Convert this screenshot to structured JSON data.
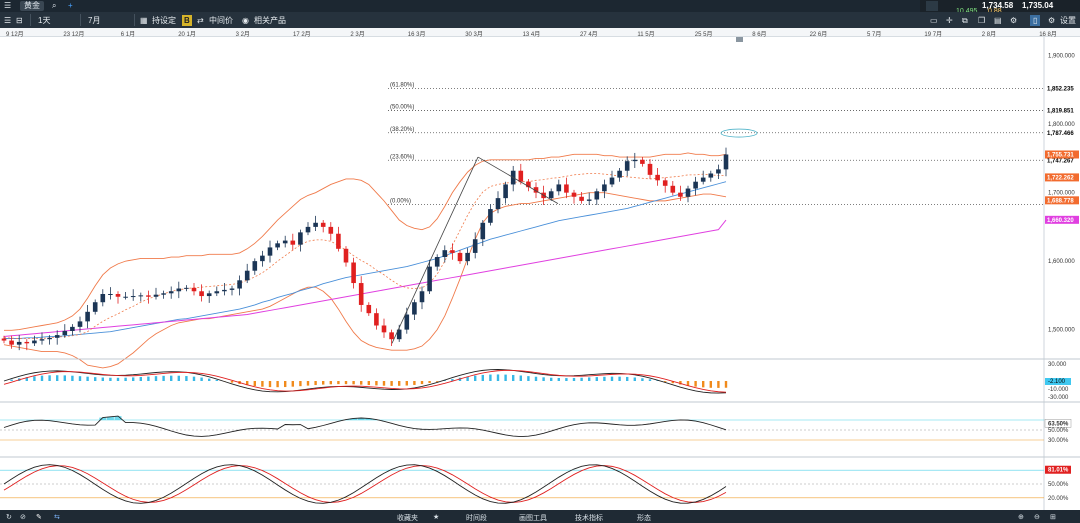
{
  "app": {
    "menu_icon": "hamburger-menu-icon",
    "instrument_tab": "黄金",
    "search_icon": "search-icon",
    "add_icon": "plus-icon",
    "quote_top": "1,734.58",
    "quote_top2": "1,735.04",
    "change_small": "10.495",
    "change_small2": "0.88"
  },
  "toolbar": {
    "interval": "1天",
    "range": "7月",
    "settings_label": "持设定",
    "badge": "B",
    "middle_price_label": "中间价",
    "related_label": "相关产品",
    "settings_right": "设置"
  },
  "date_axis": {
    "labels": [
      "9 12月",
      "23 12月",
      "6 1月",
      "20 1月",
      "3 2月",
      "17 2月",
      "2 3月",
      "16 3月",
      "30 3月",
      "13 4月",
      "27 4月",
      "11 5月",
      "25 5月",
      "8 6月",
      "22 6月",
      "5 7月",
      "19 7月",
      "2 8月",
      "16 8月"
    ]
  },
  "price_labels": {
    "p1900": "1,900.000",
    "p1852": "1,852.235",
    "p1819": "1,819.851",
    "p1800": "1,800.000",
    "p1787": "1,787.466",
    "p1755": "1,755.731",
    "p1747": "1,747.267",
    "p1722": "1,722.262",
    "p1700": "1,700.000",
    "p1688": "1,688.778",
    "p1660": "1,660.320",
    "p1600": "1,600.000",
    "p1500": "1,500.000"
  },
  "fib_labels": [
    "(61.80%)",
    "(50.00%)",
    "(38.20%)",
    "(23.60%)",
    "(0.00%)"
  ],
  "macd_labels": {
    "top": "30.000",
    "value": "-2.100",
    "mid": "-10.000",
    "bottom": "-30.000"
  },
  "rsi_labels": {
    "value": "63.50%",
    "l1": "50.00%",
    "l2": "30.00%"
  },
  "stoch_labels": {
    "value": "81.01%",
    "l1": "50.00%",
    "l2": "20.00%"
  },
  "bottom_bar": {
    "favorites": "收藏夹",
    "star": "★",
    "timeframe": "时间段",
    "drawing_tools": "画图工具",
    "indicators": "技术指标",
    "patterns": "形态"
  },
  "colors": {
    "bull": "#1b3555",
    "bear": "#e02020",
    "bollinger": "#f07a4a",
    "sma_blue": "#4a90d9",
    "sma_magenta": "#e040e0",
    "rsi_fill": "#4fd1e8"
  },
  "chart_data": {
    "type": "candlestick",
    "title": "黄金",
    "interval": "1天",
    "ylim": [
      1460,
      1920
    ],
    "x_range": [
      "9 12月",
      "16 8月"
    ],
    "fibonacci": [
      {
        "label": "(61.80%)",
        "price": 1852.235
      },
      {
        "label": "(50.00%)",
        "price": 1819.851
      },
      {
        "label": "(38.20%)",
        "price": 1787.466
      },
      {
        "label": "(23.60%)",
        "price": 1747.267
      },
      {
        "label": "(0.00%)",
        "price": 1682.5
      }
    ],
    "last_price": 1755.731,
    "series": [
      {
        "name": "Bollinger upper",
        "values": [
          1499,
          1499,
          1500,
          1502,
          1504,
          1506,
          1508,
          1510,
          1514,
          1520,
          1530,
          1546,
          1564,
          1580,
          1590,
          1596,
          1600,
          1602,
          1604,
          1604,
          1604,
          1604,
          1606,
          1606,
          1608,
          1608,
          1608,
          1610,
          1610,
          1610,
          1610,
          1612,
          1618,
          1626,
          1636,
          1648,
          1660,
          1670,
          1680,
          1690,
          1696,
          1700,
          1706,
          1712,
          1716,
          1720,
          1720,
          1718,
          1712,
          1700,
          1688,
          1674,
          1660,
          1652,
          1648,
          1646,
          1650,
          1662,
          1680,
          1700,
          1716,
          1730,
          1740,
          1746,
          1748,
          1748,
          1748,
          1748,
          1748,
          1748,
          1750,
          1750,
          1752,
          1752,
          1754,
          1756,
          1756,
          1756,
          1756,
          1754,
          1754,
          1752,
          1752,
          1752,
          1752,
          1752,
          1754,
          1756,
          1756,
          1756,
          1758,
          1756,
          1756,
          1754,
          1754,
          1756
        ]
      },
      {
        "name": "Bollinger lower",
        "values": [
          1478,
          1476,
          1474,
          1472,
          1470,
          1468,
          1468,
          1468,
          1466,
          1462,
          1456,
          1448,
          1446,
          1444,
          1446,
          1450,
          1458,
          1466,
          1476,
          1486,
          1494,
          1500,
          1506,
          1510,
          1512,
          1514,
          1516,
          1516,
          1518,
          1520,
          1522,
          1524,
          1526,
          1528,
          1530,
          1534,
          1540,
          1546,
          1552,
          1558,
          1562,
          1562,
          1556,
          1546,
          1530,
          1512,
          1496,
          1484,
          1478,
          1474,
          1472,
          1470,
          1470,
          1470,
          1472,
          1476,
          1486,
          1500,
          1520,
          1546,
          1574,
          1604,
          1632,
          1656,
          1670,
          1676,
          1680,
          1682,
          1684,
          1684,
          1686,
          1688,
          1690,
          1692,
          1694,
          1696,
          1698,
          1700,
          1700,
          1700,
          1698,
          1696,
          1694,
          1692,
          1690,
          1688,
          1688,
          1688,
          1690,
          1692,
          1694,
          1696,
          1698,
          1698,
          1696,
          1694
        ]
      },
      {
        "name": "SMA blue",
        "values": [
          1487,
          1487,
          1487,
          1488,
          1488,
          1489,
          1490,
          1490,
          1491,
          1492,
          1493,
          1494,
          1495,
          1496,
          1497,
          1499,
          1501,
          1503,
          1505,
          1507,
          1509,
          1511,
          1513,
          1515,
          1516,
          1518,
          1520,
          1522,
          1524,
          1526,
          1528,
          1530,
          1533,
          1536,
          1540,
          1543,
          1547,
          1550,
          1553,
          1557,
          1560,
          1563,
          1567,
          1570,
          1573,
          1576,
          1578,
          1580,
          1582,
          1584,
          1586,
          1588,
          1590,
          1592,
          1595,
          1598,
          1601,
          1604,
          1608,
          1612,
          1616,
          1620,
          1624,
          1628,
          1632,
          1635,
          1638,
          1641,
          1644,
          1647,
          1650,
          1653,
          1656,
          1659,
          1661,
          1663,
          1665,
          1667,
          1669,
          1671,
          1673,
          1675,
          1677,
          1680,
          1683,
          1686,
          1689,
          1692,
          1695,
          1698,
          1701,
          1704,
          1707,
          1710,
          1713,
          1716
        ]
      },
      {
        "name": "SMA magenta",
        "values": [
          1490,
          1491,
          1492,
          1493,
          1494,
          1495,
          1496,
          1497,
          1498,
          1499,
          1500,
          1501,
          1502,
          1503,
          1504,
          1505,
          1506,
          1507,
          1508,
          1509,
          1510,
          1511,
          1512,
          1513,
          1514,
          1515,
          1516,
          1517,
          1518,
          1519,
          1520,
          1521,
          1522,
          1524,
          1526,
          1528,
          1530,
          1532,
          1534,
          1536,
          1538,
          1540,
          1542,
          1544,
          1546,
          1548,
          1550,
          1552,
          1554,
          1556,
          1558,
          1560,
          1562,
          1564,
          1566,
          1568,
          1570,
          1572,
          1574,
          1576,
          1578,
          1580,
          1582,
          1584,
          1586,
          1588,
          1590,
          1592,
          1594,
          1596,
          1598,
          1600,
          1602,
          1604,
          1606,
          1608,
          1610,
          1612,
          1614,
          1616,
          1618,
          1620,
          1622,
          1624,
          1626,
          1628,
          1630,
          1632,
          1634,
          1636,
          1638,
          1640,
          1642,
          1644,
          1646,
          1660
        ]
      },
      {
        "name": "Close",
        "values": [
          1484,
          1478,
          1482,
          1480,
          1484,
          1486,
          1488,
          1492,
          1498,
          1504,
          1512,
          1526,
          1540,
          1552,
          1552,
          1548,
          1548,
          1549,
          1550,
          1548,
          1551,
          1553,
          1556,
          1560,
          1561,
          1556,
          1549,
          1553,
          1556,
          1558,
          1560,
          1572,
          1586,
          1600,
          1608,
          1620,
          1626,
          1630,
          1624,
          1642,
          1650,
          1656,
          1650,
          1640,
          1618,
          1598,
          1568,
          1536,
          1524,
          1506,
          1496,
          1486,
          1500,
          1522,
          1540,
          1556,
          1592,
          1606,
          1616,
          1612,
          1600,
          1612,
          1632,
          1656,
          1676,
          1692,
          1712,
          1732,
          1716,
          1708,
          1700,
          1692,
          1702,
          1712,
          1700,
          1694,
          1688,
          1690,
          1702,
          1712,
          1722,
          1732,
          1746,
          1748,
          1742,
          1726,
          1718,
          1710,
          1700,
          1694,
          1706,
          1716,
          1722,
          1728,
          1734,
          1755.731
        ]
      }
    ],
    "indicators": {
      "macd": {
        "ylim": [
          -30,
          30
        ],
        "value": -2.1
      },
      "rsi": {
        "ylim": [
          0,
          100
        ],
        "value": 63.5,
        "levels": [
          50,
          30
        ]
      },
      "stochastic": {
        "ylim": [
          0,
          100
        ],
        "value": 81.01,
        "levels": [
          50,
          20
        ]
      }
    }
  }
}
